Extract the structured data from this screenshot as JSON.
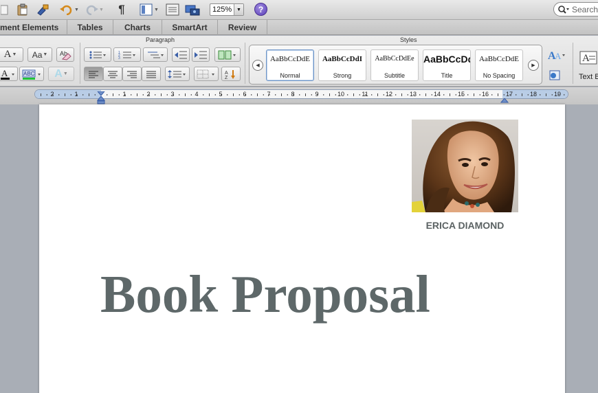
{
  "toolbar": {
    "zoom_value": "125%",
    "help_label": "?",
    "search_placeholder": "Search"
  },
  "tabs": [
    {
      "label": "ment Elements"
    },
    {
      "label": "Tables"
    },
    {
      "label": "Charts"
    },
    {
      "label": "SmartArt"
    },
    {
      "label": "Review"
    }
  ],
  "ribbon": {
    "paragraph_label": "Paragraph",
    "styles_label": "Styles",
    "text_box_label": "Text B",
    "styles": [
      {
        "sample": "AaBbCcDdE",
        "name": "Normal"
      },
      {
        "sample": "AaBbCcDdI",
        "name": "Strong"
      },
      {
        "sample": "AaBbCcDdEe",
        "name": "Subtitle"
      },
      {
        "sample": "AaBbCcDd",
        "name": "Title"
      },
      {
        "sample": "AaBbCcDdE",
        "name": "No Spacing"
      }
    ]
  },
  "ruler": {
    "labels": [
      "2",
      "1",
      "1",
      "2",
      "3",
      "4",
      "5",
      "6",
      "7",
      "8",
      "9",
      "10",
      "11",
      "12",
      "13",
      "14",
      "15",
      "16",
      "17",
      "18",
      "19"
    ]
  },
  "document": {
    "author_name": "ERICA DIAMOND",
    "title": "Book Proposal"
  },
  "colors": {
    "title_text": "#5e6869",
    "author_text": "#5b6263",
    "ruler_margin": "#b9cde6",
    "help_button": "#5a3fb8"
  }
}
